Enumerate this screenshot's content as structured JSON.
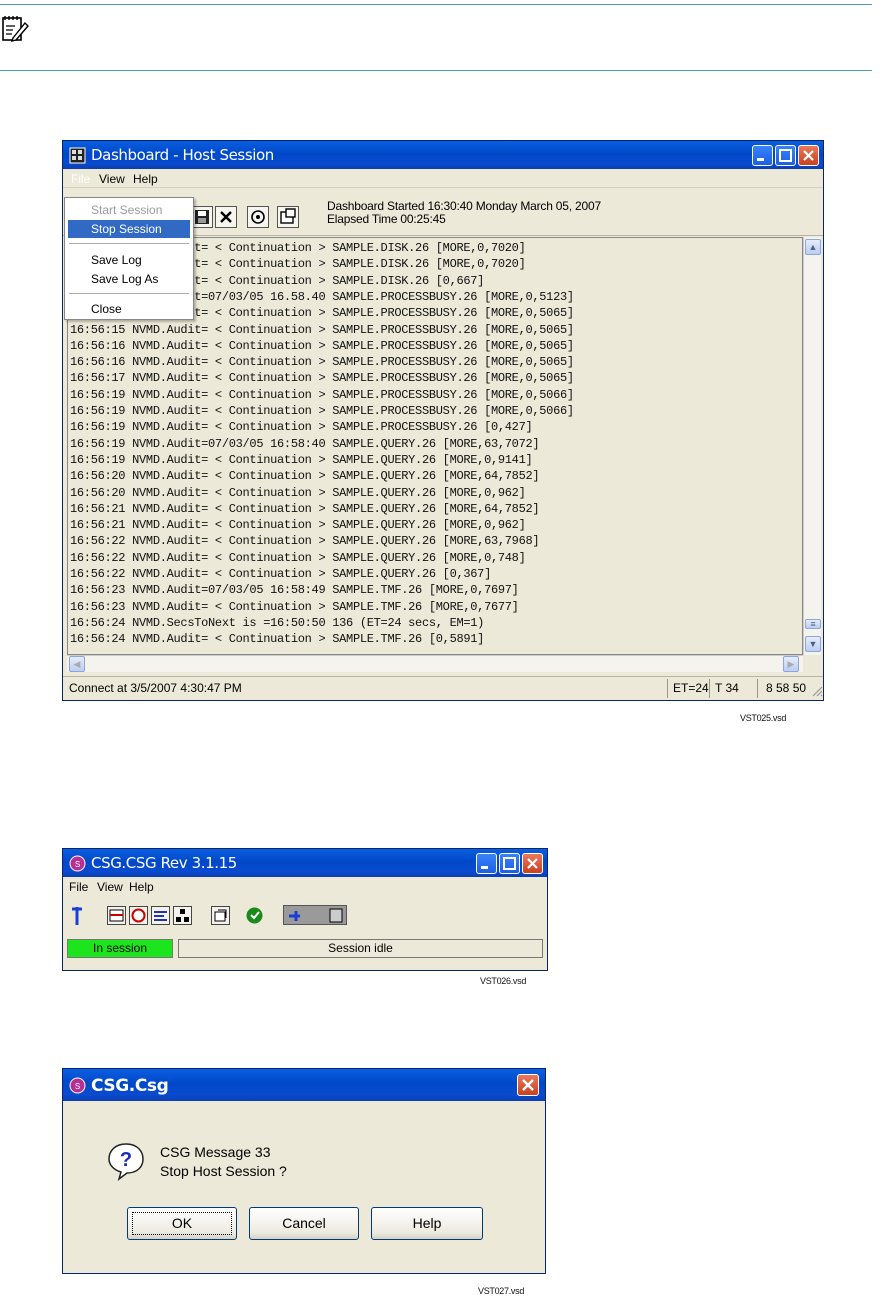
{
  "dashboard": {
    "title": "Dashboard - Host Session",
    "menu": [
      "File",
      "View",
      "Help"
    ],
    "file_menu": [
      "Start Session",
      "Stop Session",
      "Save Log",
      "Save Log As",
      "Close"
    ],
    "status_line1": "Dashboard Started 16:30:40 Monday  March 05, 2007",
    "status_line2": "Elapsed Time 00:25:45",
    "log_lines": [
      "16:55:13 NVMD.Audit= < Continuation > SAMPLE.DISK.26 [MORE,0,7020]",
      "16:55:13 NVMD.Audit= < Continuation > SAMPLE.DISK.26 [MORE,0,7020]",
      "16:55:13 NVMD.Audit= < Continuation > SAMPLE.DISK.26 [0,667]",
      "16:55:14 NVMD.Audit=07/03/05 16.58.40 SAMPLE.PROCESSBUSY.26 [MORE,0,5123]",
      "16:55:14 NVMD.Audit= < Continuation > SAMPLE.PROCESSBUSY.26 [MORE,0,5065]",
      "16:56:15 NVMD.Audit= < Continuation > SAMPLE.PROCESSBUSY.26 [MORE,0,5065]",
      "16:56:16 NVMD.Audit= < Continuation > SAMPLE.PROCESSBUSY.26 [MORE,0,5065]",
      "16:56:16 NVMD.Audit= < Continuation > SAMPLE.PROCESSBUSY.26 [MORE,0,5065]",
      "16:56:17 NVMD.Audit= < Continuation > SAMPLE.PROCESSBUSY.26 [MORE,0,5065]",
      "16:56:19 NVMD.Audit= < Continuation > SAMPLE.PROCESSBUSY.26 [MORE,0,5066]",
      "16:56:19 NVMD.Audit= < Continuation > SAMPLE.PROCESSBUSY.26 [MORE,0,5066]",
      "16:56:19 NVMD.Audit= < Continuation > SAMPLE.PROCESSBUSY.26 [0,427]",
      "16:56:19 NVMD.Audit=07/03/05 16:58:40 SAMPLE.QUERY.26 [MORE,63,7072]",
      "16:56:19 NVMD.Audit= < Continuation > SAMPLE.QUERY.26 [MORE,0,9141]",
      "16:56:20 NVMD.Audit= < Continuation > SAMPLE.QUERY.26 [MORE,64,7852]",
      "16:56:20 NVMD.Audit= < Continuation > SAMPLE.QUERY.26 [MORE,0,962]",
      "16:56:21 NVMD.Audit= < Continuation > SAMPLE.QUERY.26 [MORE,64,7852]",
      "16:56:21 NVMD.Audit= < Continuation > SAMPLE.QUERY.26 [MORE,0,962]",
      "16:56:22 NVMD.Audit= < Continuation > SAMPLE.QUERY.26 [MORE,63,7968]",
      "16:56:22 NVMD.Audit= < Continuation > SAMPLE.QUERY.26 [MORE,0,748]",
      "16:56:22 NVMD.Audit= < Continuation > SAMPLE.QUERY.26 [0,367]",
      "16:56:23 NVMD.Audit=07/03/05 16:58:49 SAMPLE.TMF.26 [MORE,0,7697]",
      "16:56:23 NVMD.Audit= < Continuation > SAMPLE.TMF.26 [MORE,0,7677]",
      "16:56:24 NVMD.SecsToNext is =16:50:50 136 (ET=24 secs, EM=1)",
      "16:56:24 NVMD.Audit= < Continuation > SAMPLE.TMF.26 [0,5891]"
    ],
    "status_connect": "Connect at 3/5/2007 4:30:47 PM",
    "status_et": "ET=24",
    "status_t": "T 34",
    "status_clock": "8 58 50",
    "caption": "VST025.vsd"
  },
  "csg": {
    "title": "CSG.CSG Rev 3.1.15",
    "menu": [
      "File",
      "View",
      "Help"
    ],
    "session_status": "In session",
    "idle_status": "Session idle",
    "caption": "VST026.vsd"
  },
  "dialog": {
    "title": "CSG.Csg",
    "message_line1": "CSG Message 33",
    "message_line2": "Stop Host Session ?",
    "buttons": [
      "OK",
      "Cancel",
      "Help"
    ],
    "caption": "VST027.vsd"
  },
  "icons": {
    "note": "note-icon",
    "app": "dashboard-icon",
    "csg_app": "csg-icon",
    "question": "question-icon"
  }
}
